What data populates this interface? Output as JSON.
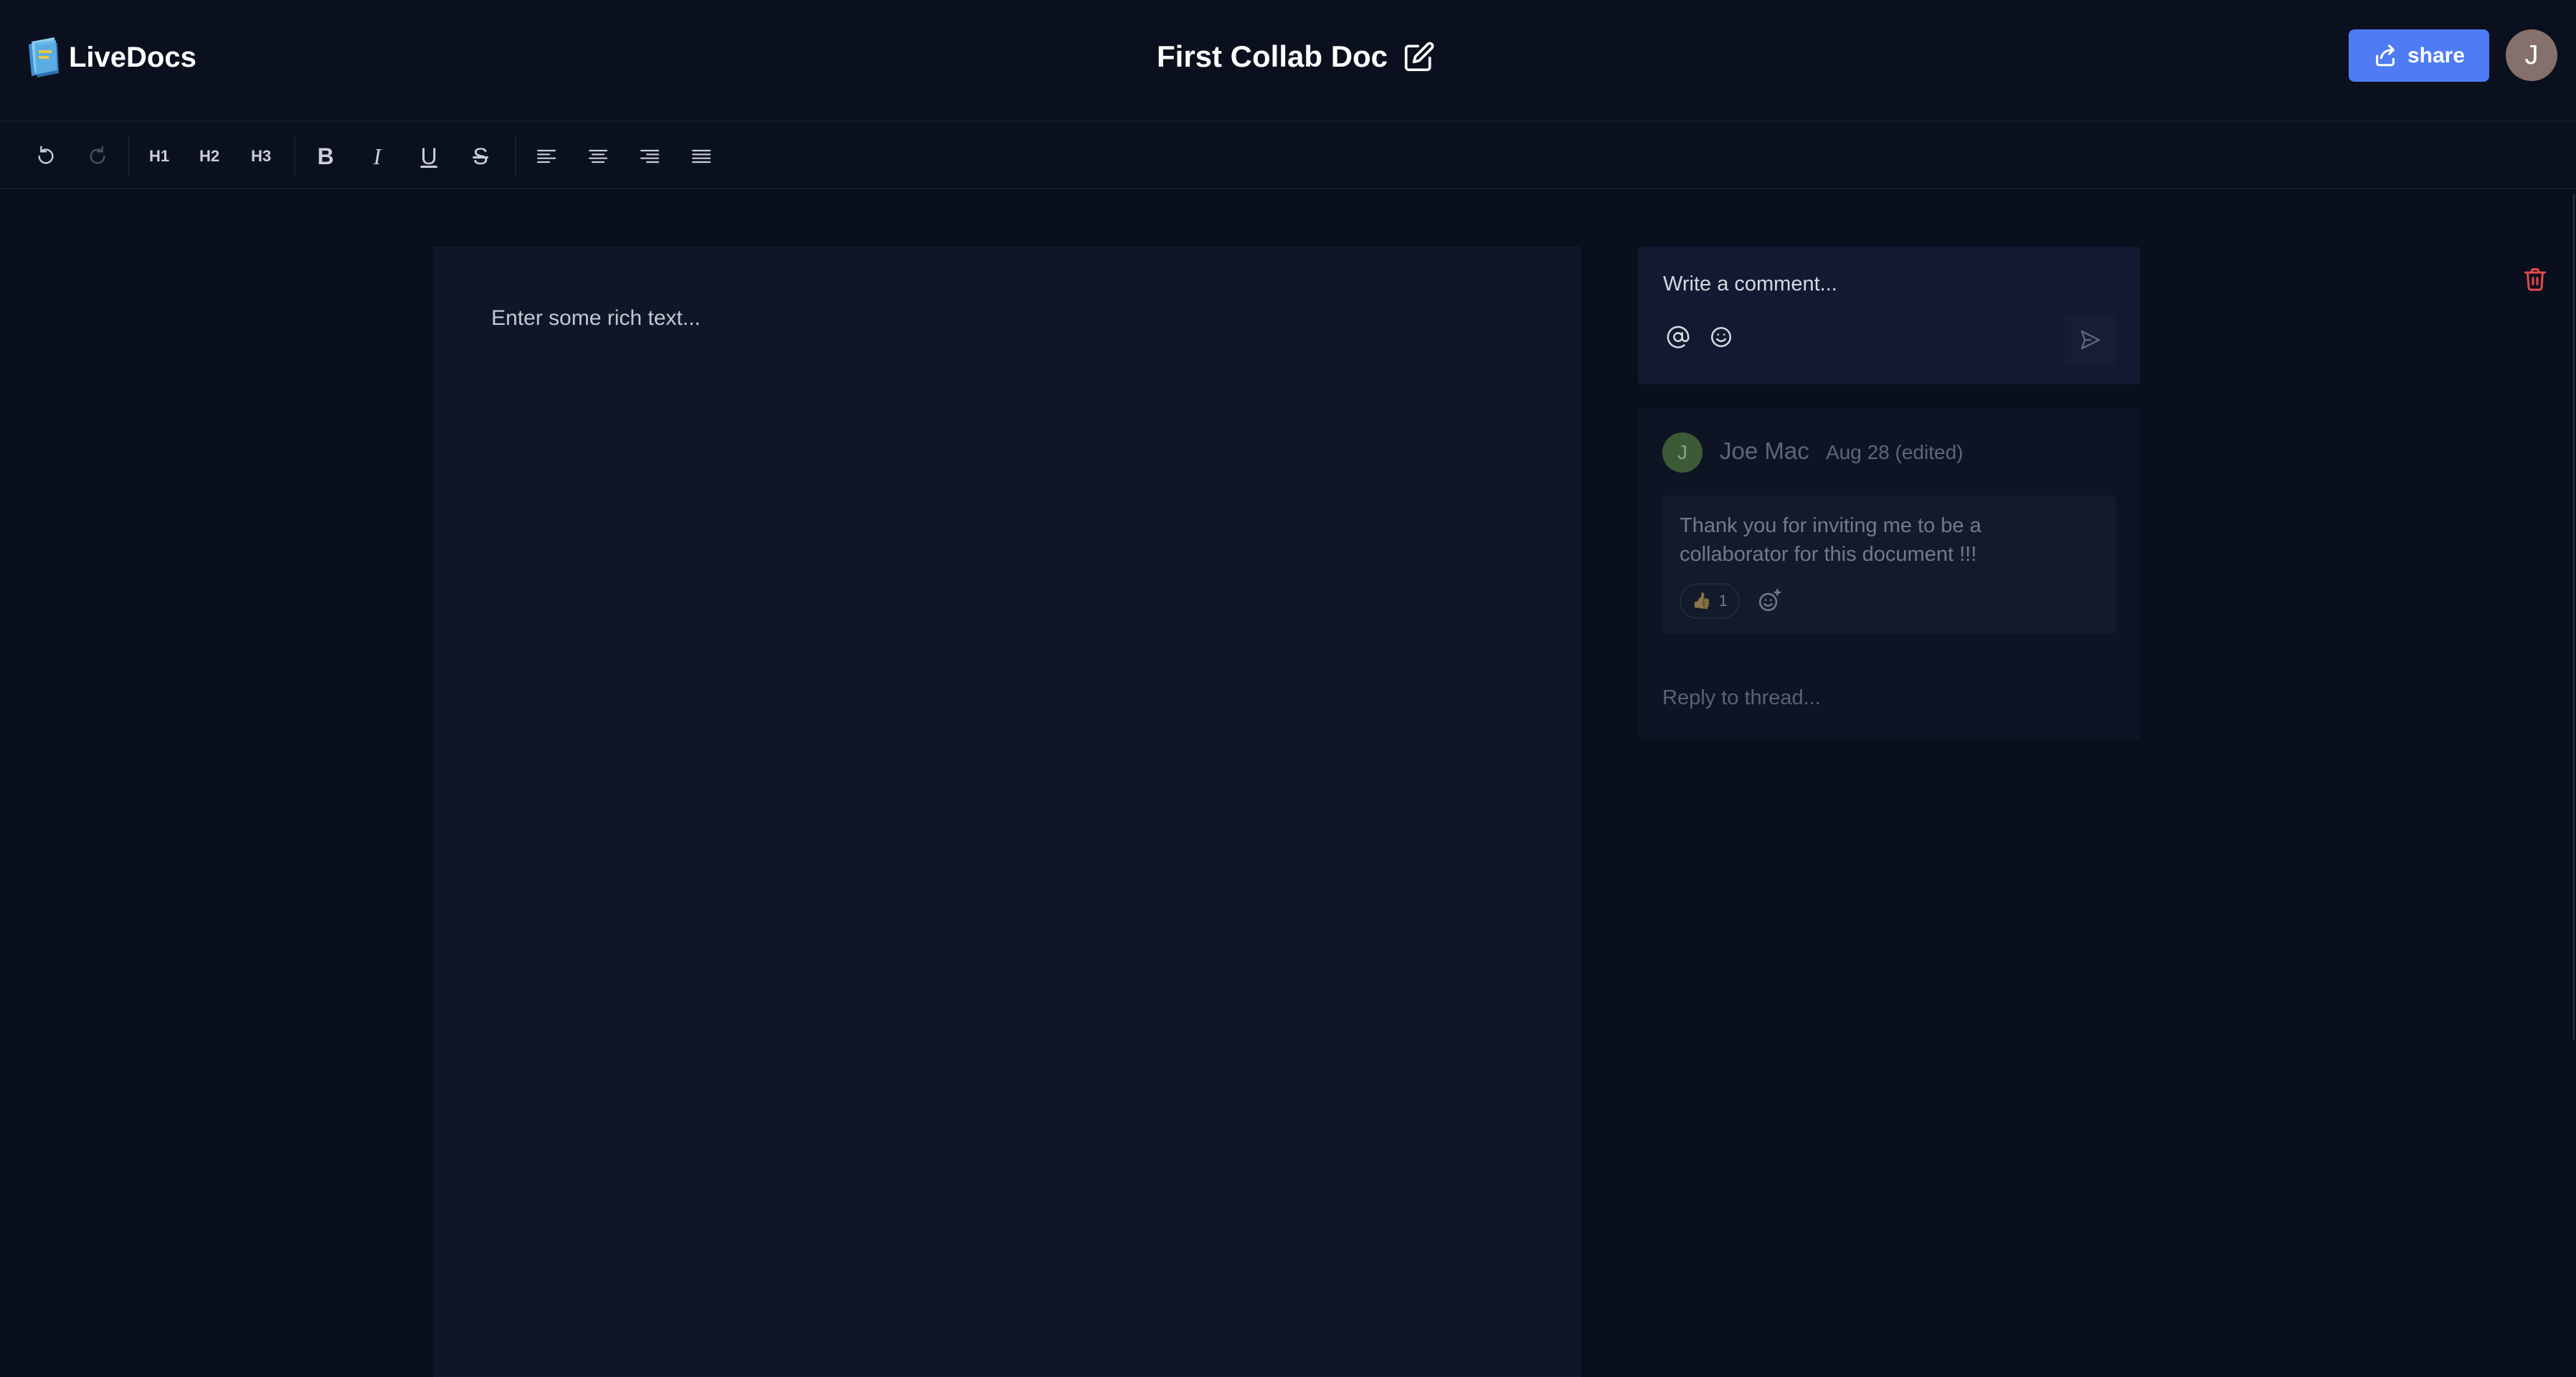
{
  "app": {
    "name": "LiveDocs"
  },
  "header": {
    "doc_title": "First Collab Doc",
    "share_label": "share",
    "avatar_initial": "J"
  },
  "toolbar": {
    "h1_label": "H1",
    "h2_label": "H2",
    "h3_label": "H3",
    "bold_label": "B",
    "italic_label": "I",
    "underline_label": "U",
    "strike_label": "S"
  },
  "editor": {
    "placeholder": "Enter some rich text..."
  },
  "composer": {
    "placeholder": "Write a comment..."
  },
  "thread": {
    "author": "Joe Mac",
    "author_initial": "J",
    "date": "Aug 28 (edited)",
    "text": "Thank you for inviting me to be a collaborator for this document !!!",
    "reaction_emoji": "👍",
    "reaction_count": "1",
    "reply_placeholder": "Reply to thread..."
  },
  "colors": {
    "background": "#090f1d",
    "accent": "#4f7cf4",
    "danger": "#e5484d",
    "comment_avatar": "#3d5a37"
  }
}
